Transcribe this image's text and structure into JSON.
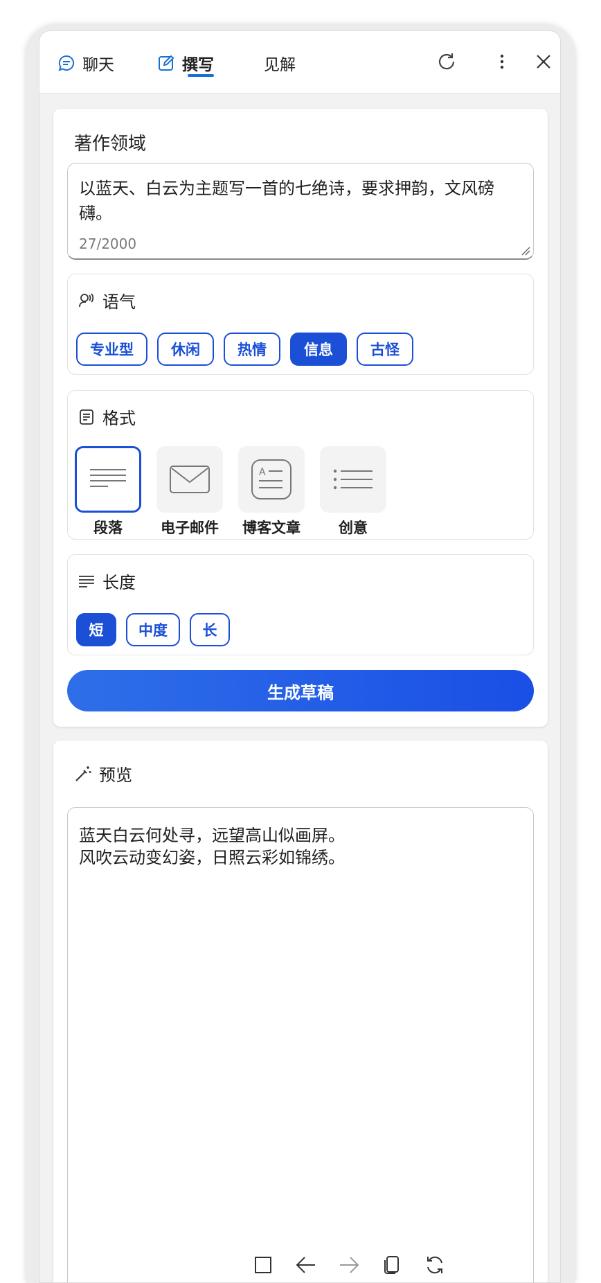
{
  "header": {
    "tabs": [
      {
        "label": "聊天",
        "icon": "chat-icon",
        "active": false
      },
      {
        "label": "撰写",
        "icon": "compose-icon",
        "active": true
      },
      {
        "label": "见解",
        "icon": "",
        "active": false
      }
    ],
    "accent": "#1a6fd6"
  },
  "compose": {
    "title": "著作领域",
    "prompt": "以蓝天、白云为主题写一首的七绝诗，要求押韵，文风磅礴。",
    "count": "27/2000",
    "tone": {
      "label": "语气",
      "options": [
        "专业型",
        "休闲",
        "热情",
        "信息",
        "古怪"
      ],
      "selected": "信息"
    },
    "format": {
      "label": "格式",
      "options": [
        "段落",
        "电子邮件",
        "博客文章",
        "创意"
      ],
      "selected": "段落"
    },
    "length": {
      "label": "长度",
      "options": [
        "短",
        "中度",
        "长"
      ],
      "selected": "短"
    },
    "generate_label": "生成草稿",
    "accent": "#1a4fd6"
  },
  "preview": {
    "title": "预览",
    "lines": [
      "蓝天白云何处寻，远望高山似画屏。",
      "风吹云动变幻姿，日照云彩如锦绣。"
    ]
  }
}
